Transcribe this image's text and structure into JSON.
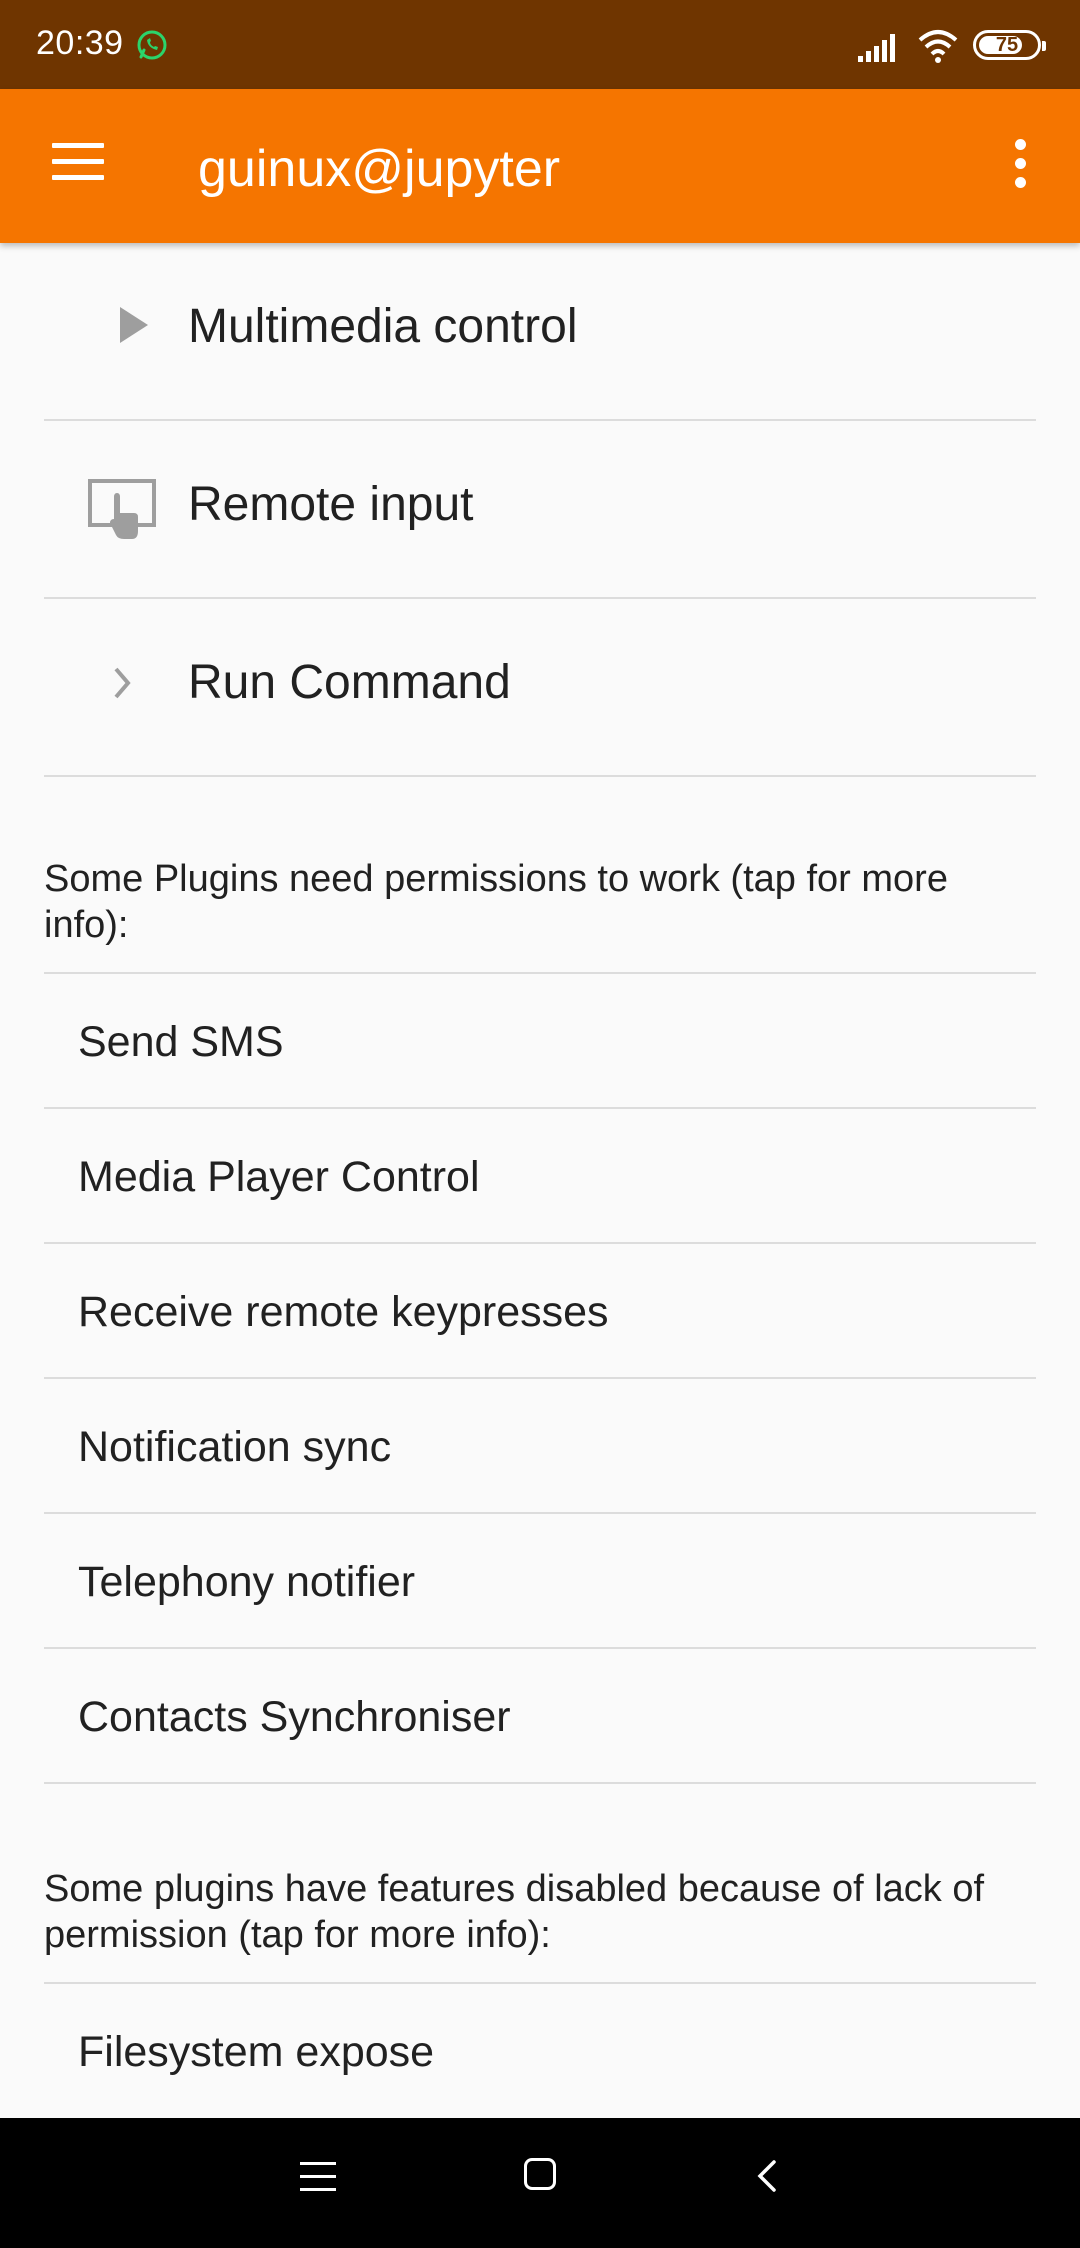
{
  "status_bar": {
    "time": "20:39",
    "battery_level": "75",
    "battery_fraction": 0.75,
    "icons": [
      "whatsapp-icon",
      "signal-icon",
      "wifi-icon",
      "battery-icon"
    ]
  },
  "app_bar": {
    "title": "guinux@jupyter",
    "background": "#f57500",
    "menu_icon": "menu-icon",
    "overflow_icon": "more-vertical-icon"
  },
  "plugins": [
    {
      "label": "Multimedia control",
      "icon": "play-icon"
    },
    {
      "label": "Remote input",
      "icon": "touchpad-icon"
    },
    {
      "label": "Run Command",
      "icon": "chevron-right-icon"
    }
  ],
  "permissions_section": {
    "header": "Some Plugins need permissions to work (tap for more info):",
    "items": [
      "Send SMS",
      "Media Player Control",
      "Receive remote keypresses",
      "Notification sync",
      "Telephony notifier",
      "Contacts Synchroniser"
    ]
  },
  "disabled_section": {
    "header": "Some plugins have features disabled because of lack of permission (tap for more info):",
    "items": [
      "Filesystem expose"
    ]
  },
  "nav_bar": {
    "icons": [
      "recents-icon",
      "home-icon",
      "back-icon"
    ]
  }
}
